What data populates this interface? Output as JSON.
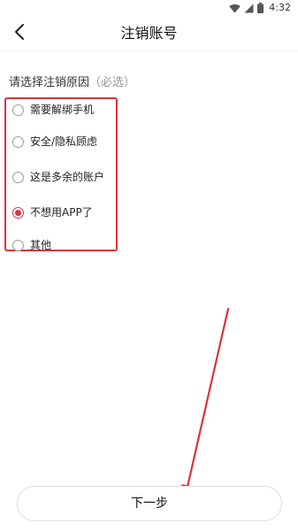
{
  "status_bar": {
    "time": "4:32",
    "icons": [
      "wifi-icon",
      "signal-icon",
      "battery-icon"
    ]
  },
  "header": {
    "title": "注销账号",
    "back_icon": "chevron-left-icon"
  },
  "form": {
    "label": "请选择注销原因",
    "hint": "（必选）",
    "reasons": [
      {
        "label": "需要解绑手机",
        "checked": false
      },
      {
        "label": "安全/隐私顾虑",
        "checked": false
      },
      {
        "label": "这是多余的账户",
        "checked": false
      },
      {
        "label": "不想用APP了",
        "checked": true
      },
      {
        "label": "其他",
        "checked": false
      }
    ]
  },
  "footer": {
    "next_label": "下一步"
  },
  "colors": {
    "accent": "#d9343c",
    "annotation": "#d9343c"
  }
}
